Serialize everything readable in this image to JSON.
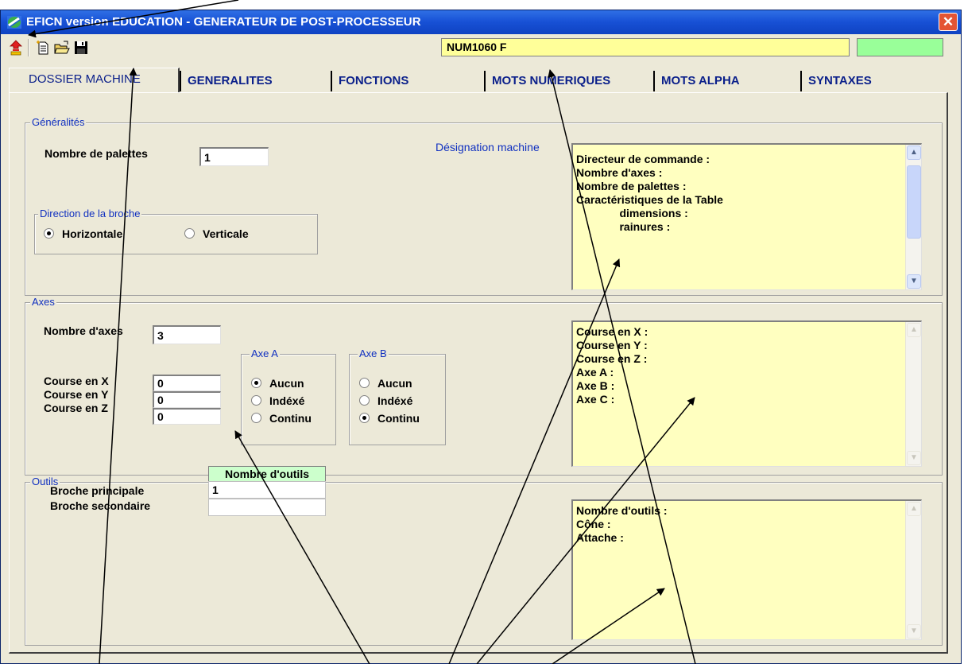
{
  "window": {
    "title": "EFICN version EDUCATION -  GENERATEUR DE POST-PROCESSEUR",
    "close_label": "✕"
  },
  "toolbar": {
    "icons": [
      "exit-icon",
      "new-file-icon",
      "open-folder-icon",
      "save-disk-icon"
    ],
    "machine_name": "NUM1060 F",
    "status_color": "#99ff99"
  },
  "tabs": [
    {
      "label": "DOSSIER MACHINE",
      "active": true
    },
    {
      "label": "GENERALITES"
    },
    {
      "label": "FONCTIONS"
    },
    {
      "label": "MOTS NUMERIQUES"
    },
    {
      "label": "MOTS ALPHA"
    },
    {
      "label": "SYNTAXES"
    }
  ],
  "generalites": {
    "legend": "Généralités",
    "palettes_label": "Nombre de palettes",
    "palettes_value": "1",
    "designation_label": "Désignation machine",
    "direction": {
      "legend": "Direction de la broche",
      "options": [
        "Horizontale",
        "Verticale"
      ],
      "selected": "Horizontale"
    },
    "memo": [
      "Directeur de commande :",
      "",
      "Nombre d'axes :",
      "Nombre de palettes :",
      "Caractéristiques de la Table",
      "              dimensions :",
      "              rainures :"
    ]
  },
  "axes": {
    "legend": "Axes",
    "nb_axes_label": "Nombre d'axes",
    "nb_axes_value": "3",
    "course_x_label": "Course en X",
    "course_y_label": "Course en Y",
    "course_z_label": "Course en Z",
    "course_x": "0",
    "course_y": "0",
    "course_z": "0",
    "axe_a": {
      "legend": "Axe A",
      "options": [
        "Aucun",
        "Indéxé",
        "Continu"
      ],
      "selected": "Aucun"
    },
    "axe_b": {
      "legend": "Axe B",
      "options": [
        "Aucun",
        "Indéxé",
        "Continu"
      ],
      "selected": "Continu"
    },
    "memo": [
      "Course en X :",
      "Course en Y :",
      "Course en Z :",
      "",
      "Axe A :",
      "Axe B :",
      "Axe C :"
    ]
  },
  "outils": {
    "legend": "Outils",
    "grid_header": "Nombre d'outils",
    "broche_principale_label": "Broche principale",
    "broche_secondaire_label": "Broche secondaire",
    "broche_principale_value": "1",
    "broche_secondaire_value": "",
    "memo": [
      "Nombre d'outils :",
      "Cône :",
      "Attache :"
    ]
  },
  "colors": {
    "title_bar": "#1750d5",
    "memo_background": "#ffffc0",
    "machine_field": "#ffff99",
    "grid_header": "#ccffcc",
    "legend_text": "#1030c0"
  }
}
